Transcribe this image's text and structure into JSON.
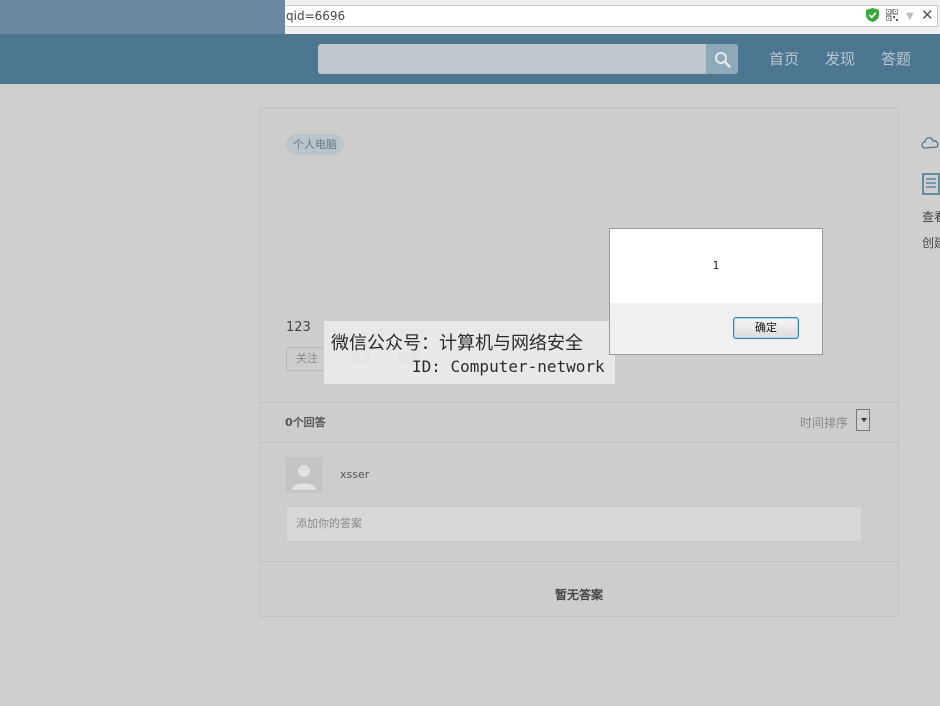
{
  "browser": {
    "url_fragment": "qid=6696"
  },
  "nav": {
    "search_placeholder": "",
    "links": [
      "首页",
      "发现",
      "答题"
    ]
  },
  "question": {
    "tag": "个人电脑",
    "title": "123",
    "buttons": [
      "关注",
      "邀请",
      "回答"
    ]
  },
  "answers": {
    "count_label": "0个回答",
    "sort_label": "时间排序",
    "username": "xsser",
    "input_placeholder": "添加你的答案",
    "empty_label": "暂无答案"
  },
  "sidebar": {
    "items": [
      "查看",
      "创建"
    ]
  },
  "watermark": {
    "line1": "微信公众号：计算机与网络安全",
    "line2": "ID: Computer-network"
  },
  "dialog": {
    "message": "1",
    "ok_label": "确定"
  },
  "colors": {
    "nav_bg": "#4d7790",
    "accent": "#3c7fb1"
  }
}
